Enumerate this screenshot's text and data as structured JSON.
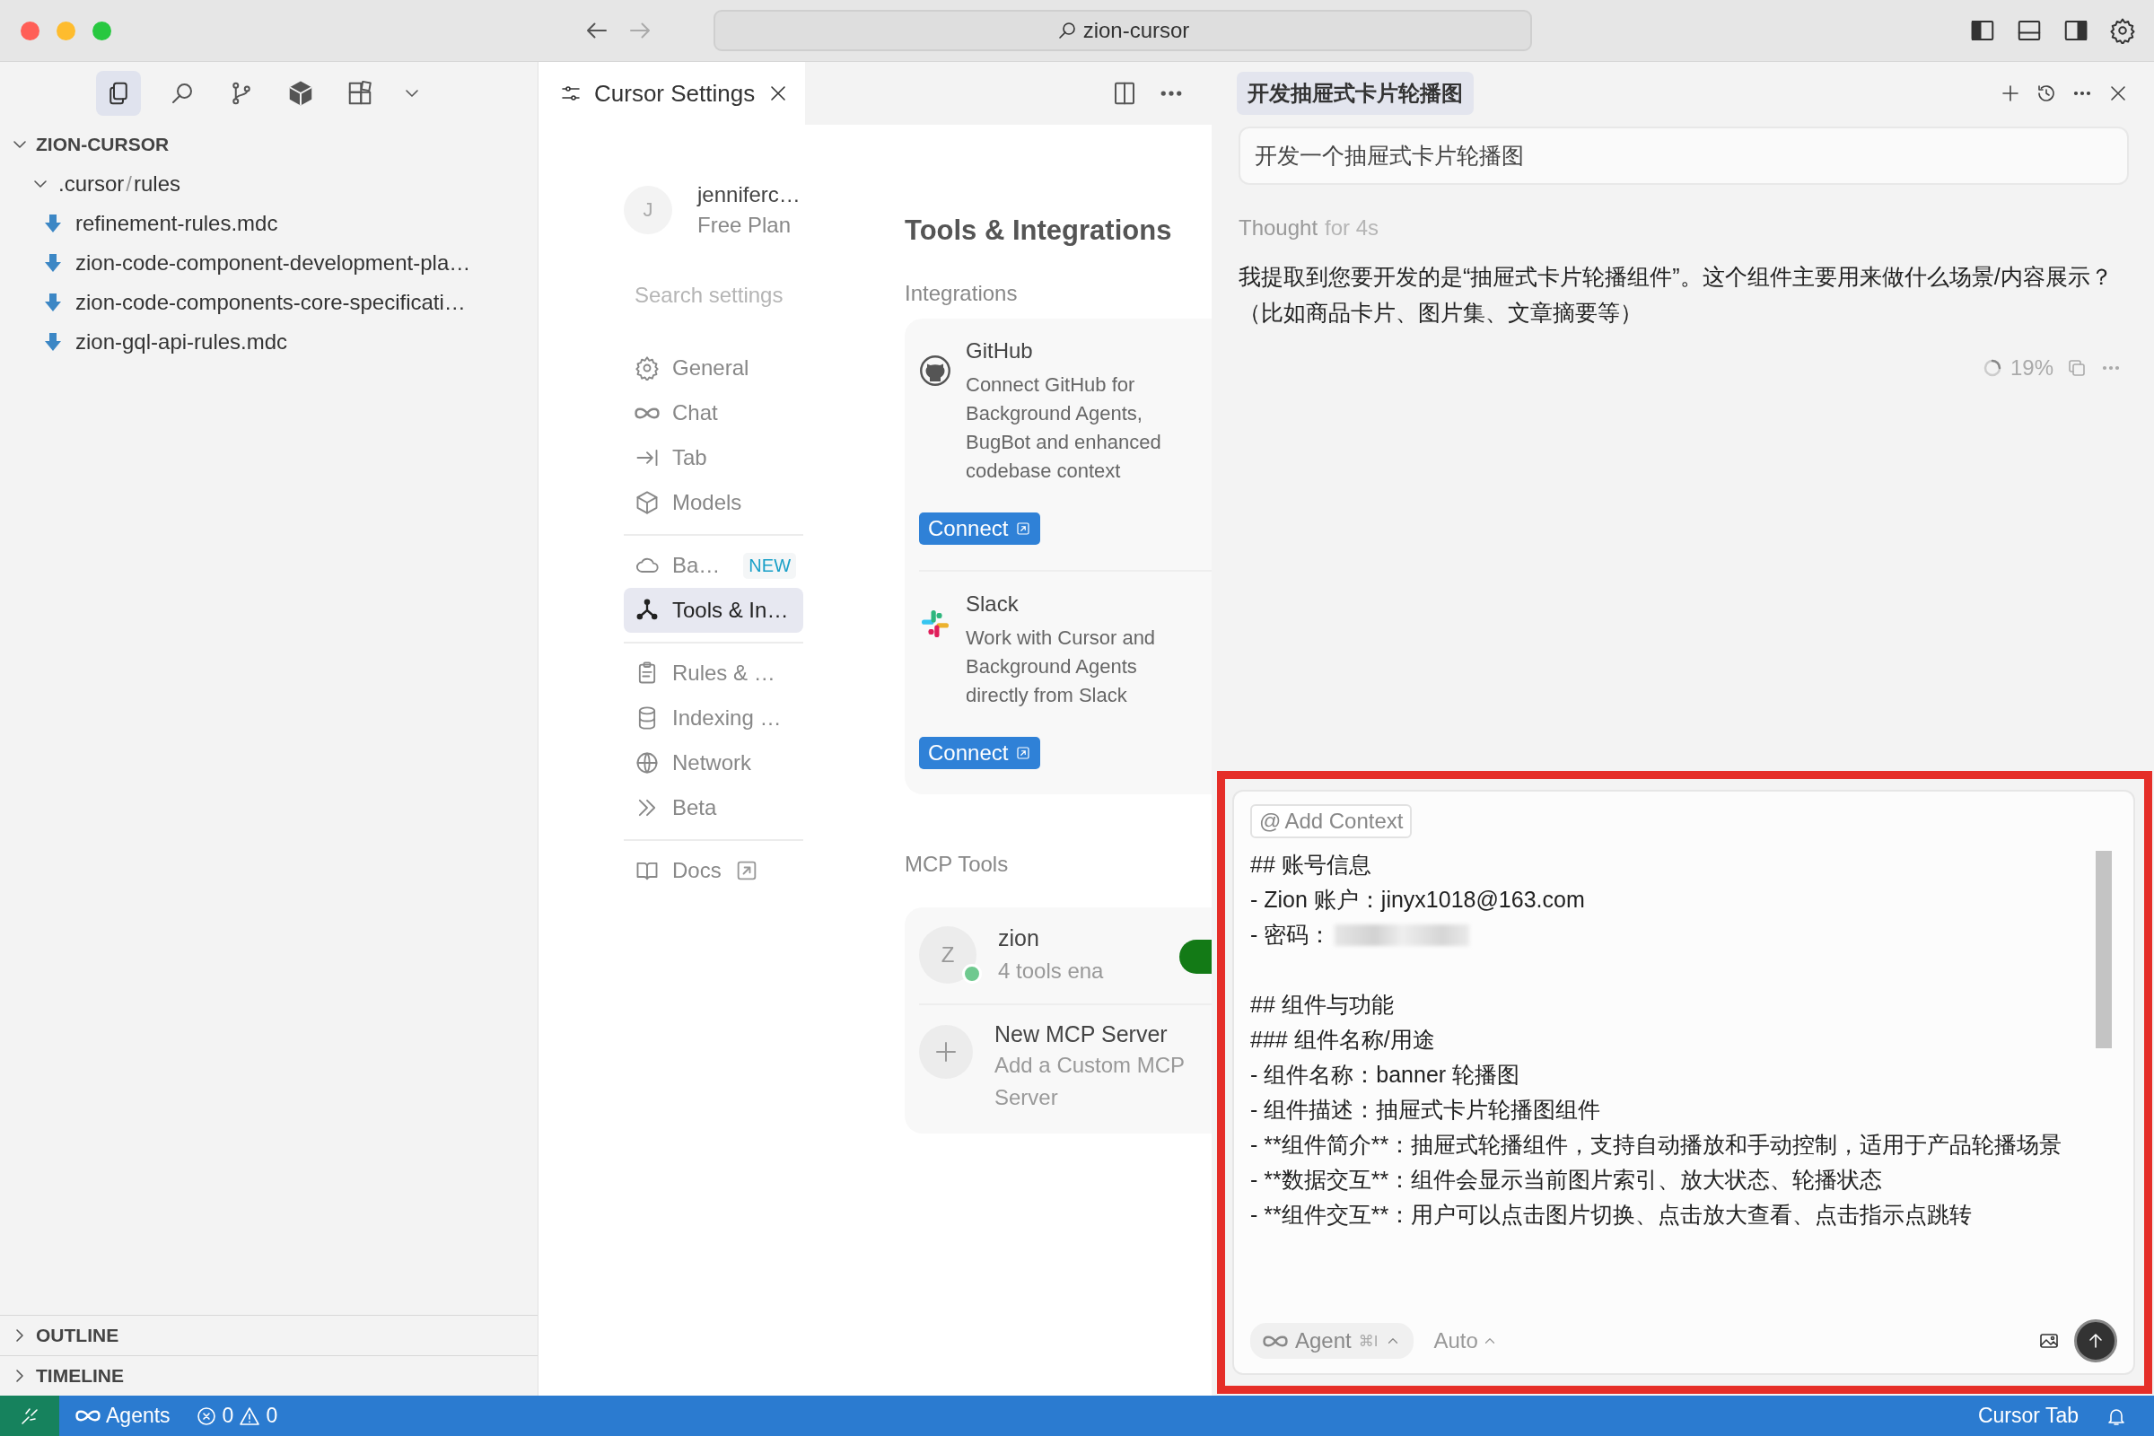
{
  "window": {
    "search": "zion-cursor"
  },
  "explorer": {
    "toolbar": [
      {
        "selected": true
      },
      {
        "selected": false
      },
      {
        "selected": false
      },
      {
        "selected": false
      },
      {
        "selected": false
      }
    ],
    "root": {
      "label": "ZION-CURSOR",
      "expanded": true,
      "children": [
        {
          "segments": [
            ".cursor",
            "/",
            "rules"
          ],
          "expanded": true,
          "children": [
            {
              "label": "refinement-rules.mdc"
            },
            {
              "label": "zion-code-component-development-pla…"
            },
            {
              "label": "zion-code-components-core-specificati…"
            },
            {
              "label": "zion-gql-api-rules.mdc"
            }
          ]
        }
      ]
    },
    "sections": [
      {
        "label": "OUTLINE",
        "expanded": false
      },
      {
        "label": "TIMELINE",
        "expanded": false
      }
    ]
  },
  "editor": {
    "tabs": [
      {
        "title": "Cursor Settings",
        "selected": true
      }
    ],
    "settings": {
      "account": {
        "initial": "J",
        "name": "jenniferc…",
        "plan": "Free Plan"
      },
      "search": {
        "placeholder": "Search settings"
      },
      "nav": [
        [
          {
            "label": "General",
            "selected": false
          },
          {
            "label": "Chat",
            "selected": false
          },
          {
            "label": "Tab",
            "selected": false
          },
          {
            "label": "Models",
            "selected": false
          }
        ],
        [
          {
            "label": "Ba…",
            "badge": "NEW",
            "selected": false
          },
          {
            "label": "Tools & In…",
            "selected": true
          }
        ],
        [
          {
            "label": "Rules & …",
            "selected": false
          },
          {
            "label": "Indexing …",
            "selected": false
          },
          {
            "label": "Network",
            "selected": false
          },
          {
            "label": "Beta",
            "selected": false
          }
        ],
        [
          {
            "label": "Docs",
            "external": true,
            "selected": false
          }
        ]
      ],
      "title": "Tools & Integrations",
      "integrations": {
        "heading": "Integrations",
        "items": [
          {
            "name": "GitHub",
            "description": "Connect GitHub for Background Agents, BugBot and enhanced codebase context",
            "button": "Connect"
          },
          {
            "name": "Slack",
            "description": "Work with Cursor and Background Agents directly from Slack",
            "button": "Connect"
          }
        ]
      },
      "mcp": {
        "heading": "MCP Tools",
        "servers": [
          {
            "initial": "Z",
            "name": "zion",
            "status": "4 tools ena",
            "color": "#6fc98f",
            "enabled": true
          }
        ],
        "add": {
          "title": "New MCP Server",
          "subtitle": "Add a Custom MCP Server"
        }
      }
    }
  },
  "chat": {
    "tab": "开发抽屉式卡片轮播图",
    "user_message": "开发一个抽屉式卡片轮播图",
    "thought": {
      "label": "Thought",
      "duration": "for 4s"
    },
    "reply": "我提取到您要开发的是“抽屉式卡片轮播组件”。这个组件主要用来做什么场景/内容展示？（比如商品卡片、图片集、文章摘要等）",
    "progress": "19%",
    "composer": {
      "context_mark": "@",
      "context": "Add Context",
      "lines": [
        {
          "text": "## 账号信息"
        },
        {
          "text": "- Zion 账户：jinyx1018@163.com"
        },
        {
          "text": "- 密码：",
          "redacted": true
        },
        {
          "text": "## 组件与功能",
          "gap_before": true
        },
        {
          "text": "### 组件名称/用途"
        },
        {
          "text": "- 组件名称：banner 轮播图"
        },
        {
          "text": "- 组件描述：抽屉式卡片轮播图组件"
        },
        {
          "text": "- **组件简介**：抽屉式轮播组件，支持自动播放和手动控制，适用于产品轮播场景"
        },
        {
          "text": "- **数据交互**：组件会显示当前图片索引、放大状态、轮播状态"
        },
        {
          "text": "- **组件交互**：用户可以点击图片切换、点击放大查看、点击指示点跳转"
        }
      ],
      "mode": "Agent",
      "shortcut": "⌘I",
      "model": "Auto"
    }
  },
  "status_bar": {
    "agents": "Agents",
    "errors": "0",
    "warnings": "0",
    "right": "Cursor Tab"
  }
}
